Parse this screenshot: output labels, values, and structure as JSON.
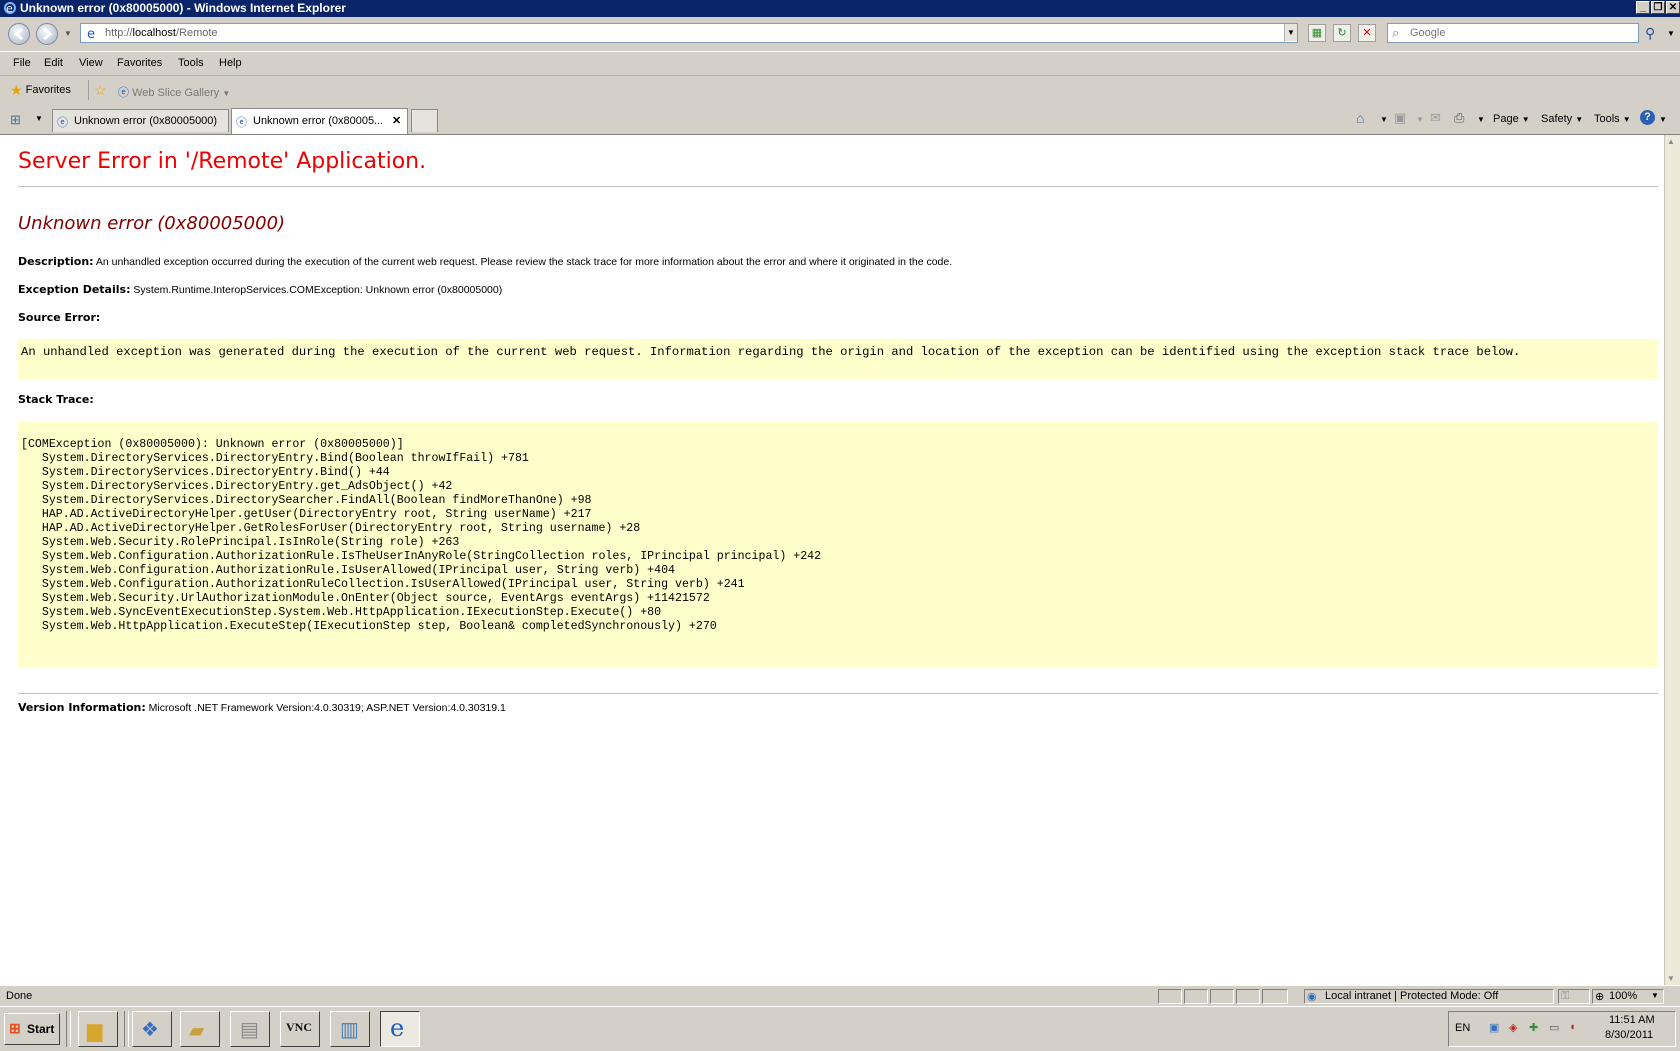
{
  "window": {
    "title": "Unknown error (0x80005000) - Windows Internet Explorer"
  },
  "address": {
    "url_prefix": "http://",
    "url_host": "localhost",
    "url_path": "/Remote"
  },
  "search": {
    "placeholder": "Google"
  },
  "menu": [
    "File",
    "Edit",
    "View",
    "Favorites",
    "Tools",
    "Help"
  ],
  "favorites": {
    "label": "Favorites",
    "web_slice": "Web Slice Gallery"
  },
  "tabs": [
    {
      "label": "Unknown error (0x80005000)"
    },
    {
      "label": "Unknown error (0x80005...",
      "close": "✕"
    }
  ],
  "commandbar": {
    "page": "Page",
    "safety": "Safety",
    "tools": "Tools"
  },
  "page": {
    "title": "Server Error in '/Remote' Application.",
    "error_title": "Unknown error (0x80005000)",
    "description_label": "Description:",
    "description_text": "An unhandled exception occurred during the execution of the current web request. Please review the stack trace for more information about the error and where it originated in the code.",
    "exception_label": "Exception Details:",
    "exception_text": "System.Runtime.InteropServices.COMException: Unknown error (0x80005000)",
    "source_label": "Source Error:",
    "source_text": "An unhandled exception was generated during the execution of the current web request. Information regarding the origin and location of the exception can be identified using the exception stack trace below.",
    "stack_label": "Stack Trace:",
    "stack_trace": [
      "[COMException (0x80005000): Unknown error (0x80005000)]",
      "   System.DirectoryServices.DirectoryEntry.Bind(Boolean throwIfFail) +781",
      "   System.DirectoryServices.DirectoryEntry.Bind() +44",
      "   System.DirectoryServices.DirectoryEntry.get_AdsObject() +42",
      "   System.DirectoryServices.DirectorySearcher.FindAll(Boolean findMoreThanOne) +98",
      "   HAP.AD.ActiveDirectoryHelper.getUser(DirectoryEntry root, String userName) +217",
      "   HAP.AD.ActiveDirectoryHelper.GetRolesForUser(DirectoryEntry root, String username) +28",
      "   System.Web.Security.RolePrincipal.IsInRole(String role) +263",
      "   System.Web.Configuration.AuthorizationRule.IsTheUserInAnyRole(StringCollection roles, IPrincipal principal) +242",
      "   System.Web.Configuration.AuthorizationRule.IsUserAllowed(IPrincipal user, String verb) +404",
      "   System.Web.Configuration.AuthorizationRuleCollection.IsUserAllowed(IPrincipal user, String verb) +241",
      "   System.Web.Security.UrlAuthorizationModule.OnEnter(Object source, EventArgs eventArgs) +11421572",
      "   System.Web.SyncEventExecutionStep.System.Web.HttpApplication.IExecutionStep.Execute() +80",
      "   System.Web.HttpApplication.ExecuteStep(IExecutionStep step, Boolean& completedSynchronously) +270"
    ],
    "version_label": "Version Information:",
    "version_text": "Microsoft .NET Framework Version:4.0.30319; ASP.NET Version:4.0.30319.1"
  },
  "status": {
    "text": "Done",
    "zone": "Local intranet | Protected Mode: Off",
    "zoom": "100%"
  },
  "taskbar": {
    "start": "Start",
    "lang": "EN",
    "time": "11:51 AM",
    "date": "8/30/2011"
  },
  "colors": {
    "title_red": "#ee0000",
    "error_maroon": "#800000",
    "code_bg": "#ffffcc",
    "titlebar_blue": "#0a246a"
  }
}
